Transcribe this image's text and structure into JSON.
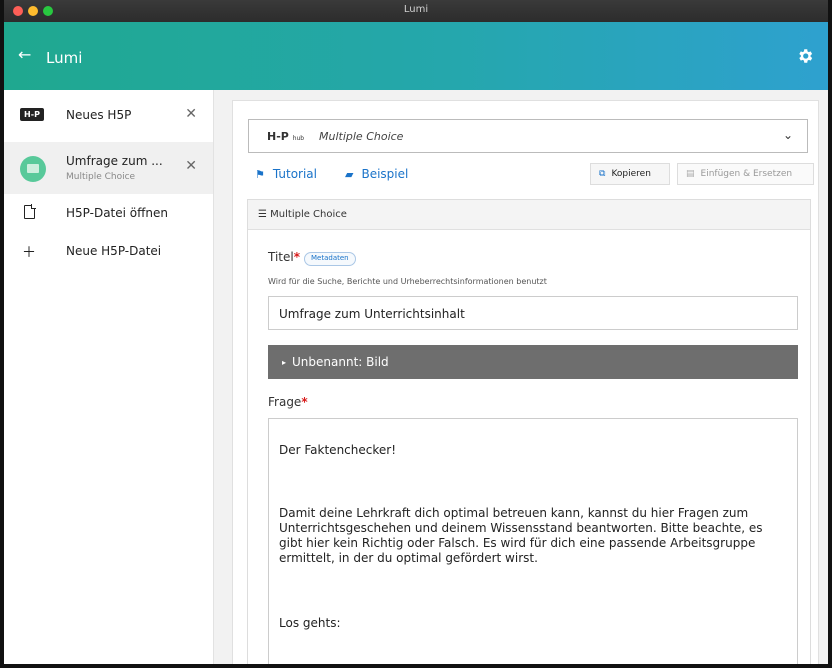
{
  "window": {
    "title": "Lumi"
  },
  "appbar": {
    "back_icon": "arrow-left-icon",
    "title": "Lumi",
    "settings_icon": "gear-icon"
  },
  "sidebar": {
    "tabs": [
      {
        "logo": "H-P",
        "title": "Neues H5P",
        "close": "✕"
      },
      {
        "icon": "multiple-choice-icon",
        "title": "Umfrage zum ...",
        "subtitle": "Multiple Choice",
        "close": "✕"
      }
    ],
    "actions": [
      {
        "icon": "file-icon",
        "label": "H5P-Datei öffnen"
      },
      {
        "icon": "plus-icon",
        "label": "Neue H5P-Datei"
      }
    ]
  },
  "editor": {
    "content_type": {
      "logo": "H-P",
      "logo_sub": "hub",
      "name": "Multiple Choice",
      "chevron": "chevron-down-icon"
    },
    "links": {
      "tutorial": "Tutorial",
      "example": "Beispiel"
    },
    "buttons": {
      "copy": "Kopieren",
      "paste": "Einfügen & Ersetzen"
    },
    "section": {
      "heading": "Multiple Choice",
      "title_label": "Titel",
      "metadata_label": "Metadaten",
      "title_desc": "Wird für die Suche, Berichte und Urheberrechtsinformationen benutzt",
      "title_value": "Umfrage zum Unterrichtsinhalt",
      "image_label": "Unbenannt: Bild",
      "question_label": "Frage",
      "question_text": {
        "p1": "Der Faktenchecker!",
        "p2": "Damit deine Lehrkraft dich optimal betreuen kann, kannst du hier Fragen zum Unterrichtsgeschehen und deinem Wissensstand beantworten. Bitte beachte, es gibt hier kein Richtig oder Falsch. Es wird für dich eine passende Arbeitsgruppe ermittelt, in der du optimal gefördert wirst.",
        "p3": "Los gehts:"
      }
    }
  },
  "colors": {
    "accent": "#1a73c9",
    "header_start": "#1fa88f",
    "header_end": "#2ea1cf",
    "required": "#d81b1b"
  }
}
